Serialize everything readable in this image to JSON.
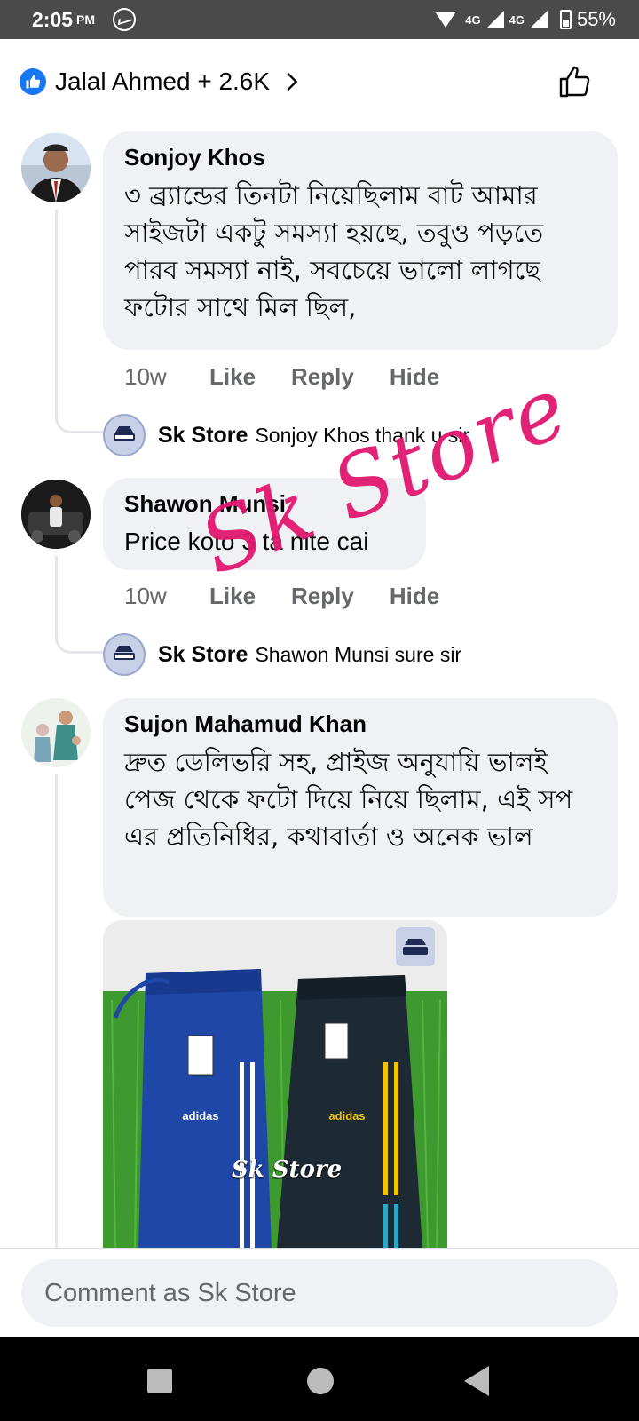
{
  "status_bar": {
    "time": "2:05",
    "ampm": "PM",
    "network_1": "4G",
    "network_2": "4G",
    "battery": "55%"
  },
  "header": {
    "reactors": "Jalal Ahmed + 2.6K",
    "like_badge_color": "#1877f2"
  },
  "comments": [
    {
      "author": "Sonjoy Khos",
      "text": "৩ ব্র্যান্ডের তিনটা নিয়েছিলাম বাট আমার সাইজটা একটু সমস্যা হয়ছে, তবুও পড়তে পারব সমস্যা নাই, সবচেয়ে ভালো লাগছে ফটোর সাথে মিল ছিল,",
      "time": "10w",
      "like": "Like",
      "reply": "Reply",
      "hide": "Hide",
      "replies": [
        {
          "author": "Sk Store",
          "text": "Sonjoy Khos thank u sir"
        }
      ]
    },
    {
      "author": "Shawon Munsi",
      "text": "Price koto 3 ta nite cai",
      "time": "10w",
      "like": "Like",
      "reply": "Reply",
      "hide": "Hide",
      "replies": [
        {
          "author": "Sk Store",
          "text": "Shawon Munsi sure sir"
        }
      ]
    },
    {
      "author": "Sujon Mahamud Khan",
      "text": "দ্রুত ডেলিভরি সহ, প্রাইজ অনুযায়ি ভালই পেজ থেকে ফটো দিয়ে নিয়ে ছিলাম, এই সপ এর প্রতিনিধির, কথাবার্তা ও অনেক ভাল",
      "photo": {
        "left_brand": "adidas",
        "right_brand": "adidas",
        "watermark": "Sk Store",
        "logo_text": "SK STORE"
      }
    }
  ],
  "overlay_watermark": "Sk Store",
  "composer": {
    "placeholder": "Comment as Sk Store"
  },
  "colors": {
    "accent": "#1877f2",
    "watermark": "#e1176f",
    "bubble": "#eff1f4",
    "muted": "#65676b"
  }
}
